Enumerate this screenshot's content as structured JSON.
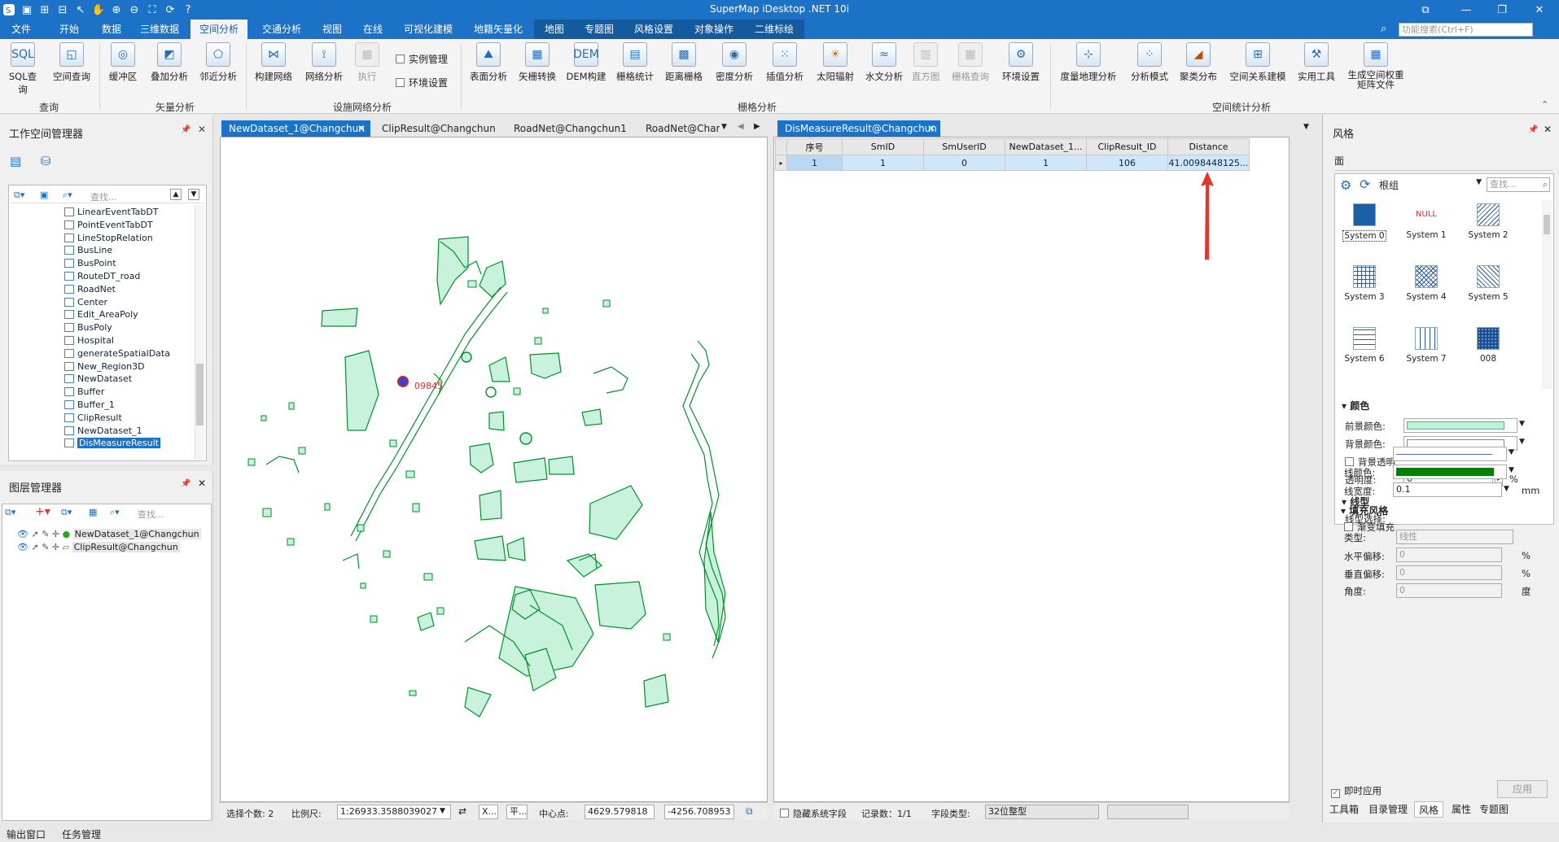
{
  "app": {
    "title": "SuperMap iDesktop .NET 10i",
    "search_placeholder": "功能搜索(Ctrl+F)"
  },
  "menu": [
    "文件",
    "开始",
    "数据",
    "三维数据",
    "空间分析",
    "交通分析",
    "视图",
    "在线",
    "可视化建模",
    "地籍矢量化",
    "地图",
    "专题图",
    "风格设置",
    "对象操作",
    "二维标绘"
  ],
  "menu_active": "空间分析",
  "ribbon": {
    "buttons": [
      "SQL查询",
      "空间查询",
      "缓冲区",
      "叠加分析",
      "邻近分析",
      "构建网络",
      "网络分析",
      "执行",
      "表面分析",
      "矢栅转换",
      "DEM构建",
      "栅格统计",
      "距离栅格",
      "密度分析",
      "插值分析",
      "太阳辐射",
      "水文分析",
      "直方图",
      "栅格查询",
      "环境设置",
      "度量地理分析",
      "分析模式",
      "聚类分布",
      "空间关系建模",
      "实用工具",
      "生成空间权重矩阵文件"
    ],
    "checkboxes": [
      "实例管理",
      "环境设置"
    ],
    "groups": [
      "查询",
      "矢量分析",
      "设施网络分析",
      "栅格分析",
      "空间统计分析"
    ]
  },
  "workspace": {
    "title": "工作空间管理器",
    "search_placeholder": "查找...",
    "items": [
      "LinearEventTabDT",
      "PointEventTabDT",
      "LineStopRelation",
      "BusLine",
      "BusPoint",
      "RouteDT_road",
      "RoadNet",
      "Center",
      "Edit_AreaPoly",
      "BusPoly",
      "Hospital",
      "generateSpatialData",
      "New_Region3D",
      "NewDataset",
      "Buffer",
      "Buffer_1",
      "ClipResult",
      "NewDataset_1",
      "DisMeasureResult"
    ],
    "selected": "DisMeasureResult"
  },
  "layers": {
    "title": "图层管理器",
    "search_placeholder": "查找...",
    "items": [
      "NewDataset_1@Changchun",
      "ClipResult@Changchun"
    ]
  },
  "map_tabs": [
    "NewDataset_1@Changchun",
    "ClipResult@Changchun",
    "RoadNet@Changchun1",
    "RoadNet@Chang"
  ],
  "map": {
    "label": "09845"
  },
  "table_tab": "DisMeasureResult@Changchun",
  "table": {
    "headers": [
      "序号",
      "SmID",
      "SmUserID",
      "NewDataset_1...",
      "ClipResult_ID",
      "Distance"
    ],
    "rows": [
      [
        "1",
        "1",
        "0",
        "1",
        "106",
        "41.0098448125..."
      ]
    ]
  },
  "status": {
    "select_count": "选择个数: 2",
    "scale_label": "比例尺:",
    "scale_value": "1:26933.3588039027",
    "btn_x": "X...",
    "btn_ping": "平...",
    "center_label": "中心点:",
    "center_x": "4629.579818",
    "center_y": "-4256.708953",
    "hide_fields": "隐藏系统字段",
    "record_count": "记录数：1/1",
    "field_type_label": "字段类型:",
    "field_type": "32位整型"
  },
  "bottom_tabs": [
    "输出窗口",
    "任务管理"
  ],
  "style_panel": {
    "title": "风格",
    "sub": "面",
    "group": "根组",
    "search_placeholder": "查找...",
    "symbols": [
      {
        "name": "System 0",
        "txt": ""
      },
      {
        "name": "System 1",
        "txt": "NULL"
      },
      {
        "name": "System 2",
        "txt": ""
      },
      {
        "name": "System 3",
        "txt": ""
      },
      {
        "name": "System 4",
        "txt": ""
      },
      {
        "name": "System 5",
        "txt": ""
      },
      {
        "name": "System 6",
        "txt": ""
      },
      {
        "name": "System 7",
        "txt": ""
      },
      {
        "name": "008",
        "txt": ""
      }
    ],
    "sec_color": "颜色",
    "fg_label": "前景颜色:",
    "bg_label": "背景颜色:",
    "bg_transparent": "背景透明",
    "opacity_label": "透明度:",
    "opacity": "0",
    "opacity_unit": "%",
    "sec_line": "线型",
    "linetype_label": "线型选择:",
    "linecolor_label": "线颜色:",
    "linewidth_label": "线宽度:",
    "linewidth": "0.1",
    "linewidth_unit": "mm",
    "sec_fill": "填充风格",
    "gradient": "渐变填充",
    "type_label": "类型:",
    "type": "线性",
    "hoff_label": "水平偏移:",
    "hoff": "0",
    "voff_label": "垂直偏移:",
    "voff": "0",
    "angle_label": "角度:",
    "angle": "0",
    "pct": "%",
    "deg": "度",
    "immediate": "即时应用",
    "apply": "应用",
    "fg_color": "#b7f5d8",
    "line_color": "#008000"
  },
  "right_tabs": [
    "工具箱",
    "目录管理",
    "风格",
    "属性",
    "专题图"
  ],
  "colors": {
    "accent": "#1b72c6",
    "feature_fill": "#c9f2dc",
    "feature_stroke": "#00902a",
    "arrow": "#e8332e"
  }
}
